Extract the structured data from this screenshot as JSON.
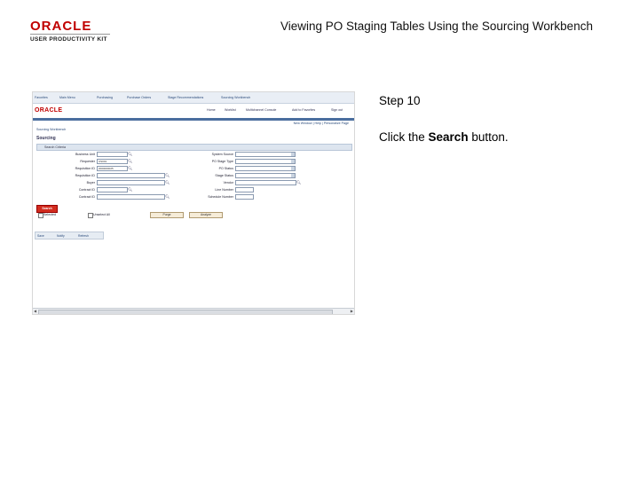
{
  "logo": {
    "brand": "ORACLE",
    "tagline": "USER PRODUCTIVITY KIT"
  },
  "title": "Viewing PO Staging Tables Using the Sourcing Workbench",
  "step": "Step 10",
  "instruction": {
    "prefix": "Click the ",
    "bold": "Search",
    "suffix": " button."
  },
  "screenshot": {
    "topnav": [
      "Favorites",
      "Main Menu",
      "Purchasing",
      "Purchase Orders",
      "Stage Recommendations",
      "Sourcing Workbench"
    ],
    "brand": "ORACLE",
    "menu": [
      "Home",
      "Worklist",
      "Multichannel Console",
      "Add to Favorites",
      "Sign out"
    ],
    "links": "New Window | Help | Personalize Page",
    "breadcrumb": "Sourcing Workbench",
    "page_title": "Sourcing",
    "section": "Search Criteria",
    "left_fields": [
      {
        "label": "Business Unit",
        "value": ""
      },
      {
        "label": "Requester",
        "value": "US001"
      },
      {
        "label": "Requisition ID",
        "value": "2000000025"
      },
      {
        "label": "Requisition ID",
        "value": ""
      },
      {
        "label": "Buyer",
        "value": ""
      },
      {
        "label": "Contract ID",
        "value": ""
      },
      {
        "label": "Contract ID",
        "value": ""
      }
    ],
    "right_fields": [
      {
        "label": "System Source",
        "value": ""
      },
      {
        "label": "PO Stage Type",
        "value": ""
      },
      {
        "label": "PO Status",
        "value": ""
      },
      {
        "label": "Stage Status",
        "value": ""
      },
      {
        "label": "Vendor",
        "value": ""
      },
      {
        "label": "Line Number",
        "value": ""
      },
      {
        "label": "Schedule Number",
        "value": ""
      }
    ],
    "search_label": "Search",
    "checkbox1": "Selected",
    "checkbox2": "Unselect All",
    "purge_label": "Purge",
    "analyze_label": "Analyze",
    "bottom_bar": [
      "Save",
      "Notify",
      "Refresh"
    ]
  }
}
